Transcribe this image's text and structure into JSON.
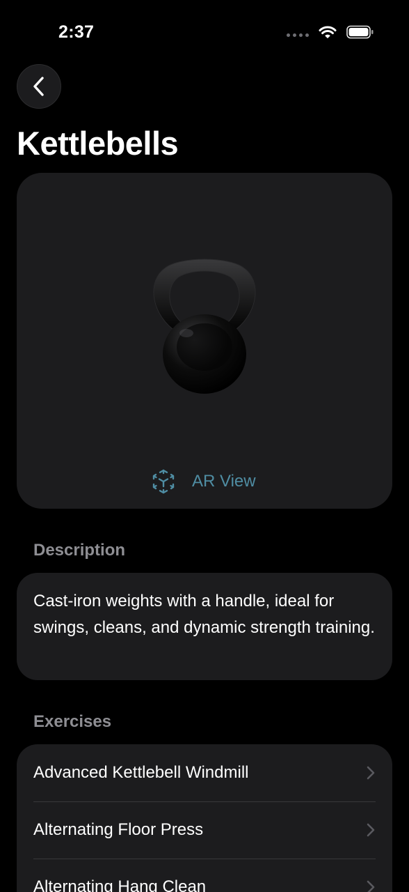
{
  "status_bar": {
    "time": "2:37"
  },
  "navigation": {
    "back_icon": "chevron-left-icon"
  },
  "page": {
    "title": "Kettlebells"
  },
  "hero": {
    "image": "kettlebell-image",
    "ar_icon": "ar-cube-icon",
    "ar_label": "AR View"
  },
  "description": {
    "header": "Description",
    "text": "Cast-iron weights with a handle, ideal for swings, cleans, and dynamic strength training."
  },
  "exercises": {
    "header": "Exercises",
    "items": [
      {
        "label": "Advanced Kettlebell Windmill"
      },
      {
        "label": "Alternating Floor Press"
      },
      {
        "label": "Alternating Hang Clean"
      }
    ]
  },
  "colors": {
    "background": "#000000",
    "card": "#1c1c1e",
    "accent": "#4f8da3",
    "secondary_text": "#8e8e93"
  }
}
